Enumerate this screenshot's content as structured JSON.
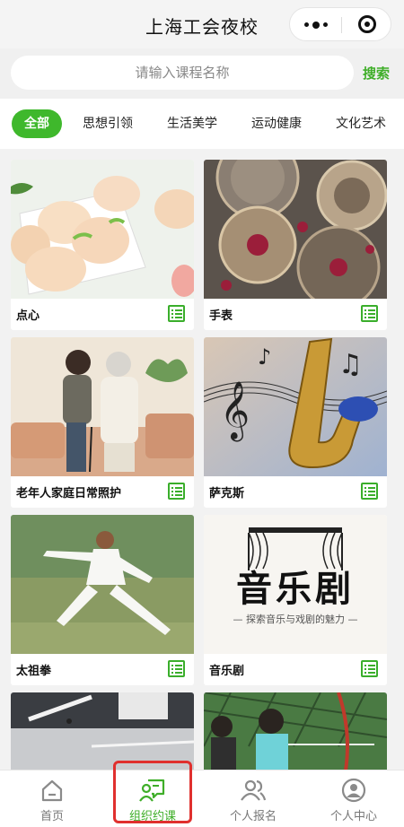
{
  "app": {
    "title": "上海工会夜校"
  },
  "capsule": {
    "more_icon": "more-dots-icon",
    "close_icon": "target-icon"
  },
  "search": {
    "placeholder": "请输入课程名称",
    "button": "搜索"
  },
  "categories": [
    {
      "label": "全部",
      "active": true
    },
    {
      "label": "思想引领",
      "active": false
    },
    {
      "label": "生活美学",
      "active": false
    },
    {
      "label": "运动健康",
      "active": false
    },
    {
      "label": "文化艺术",
      "active": false
    }
  ],
  "courses": [
    {
      "name": "点心"
    },
    {
      "name": "手表"
    },
    {
      "name": "老年人家庭日常照护"
    },
    {
      "name": "萨克斯"
    },
    {
      "name": "太祖拳"
    },
    {
      "name": "音乐剧",
      "image_title": "音乐剧",
      "image_subtitle": "— 探索音乐与戏剧的魅力 —"
    },
    {
      "name": ""
    },
    {
      "name": ""
    }
  ],
  "tabbar": [
    {
      "label": "首页",
      "icon": "home-icon",
      "active": false
    },
    {
      "label": "组织约课",
      "icon": "organize-class-icon",
      "active": true
    },
    {
      "label": "个人报名",
      "icon": "users-icon",
      "active": false
    },
    {
      "label": "个人中心",
      "icon": "profile-icon",
      "active": false
    }
  ],
  "colors": {
    "accent": "#3fb82c",
    "highlight": "#e0302e"
  }
}
